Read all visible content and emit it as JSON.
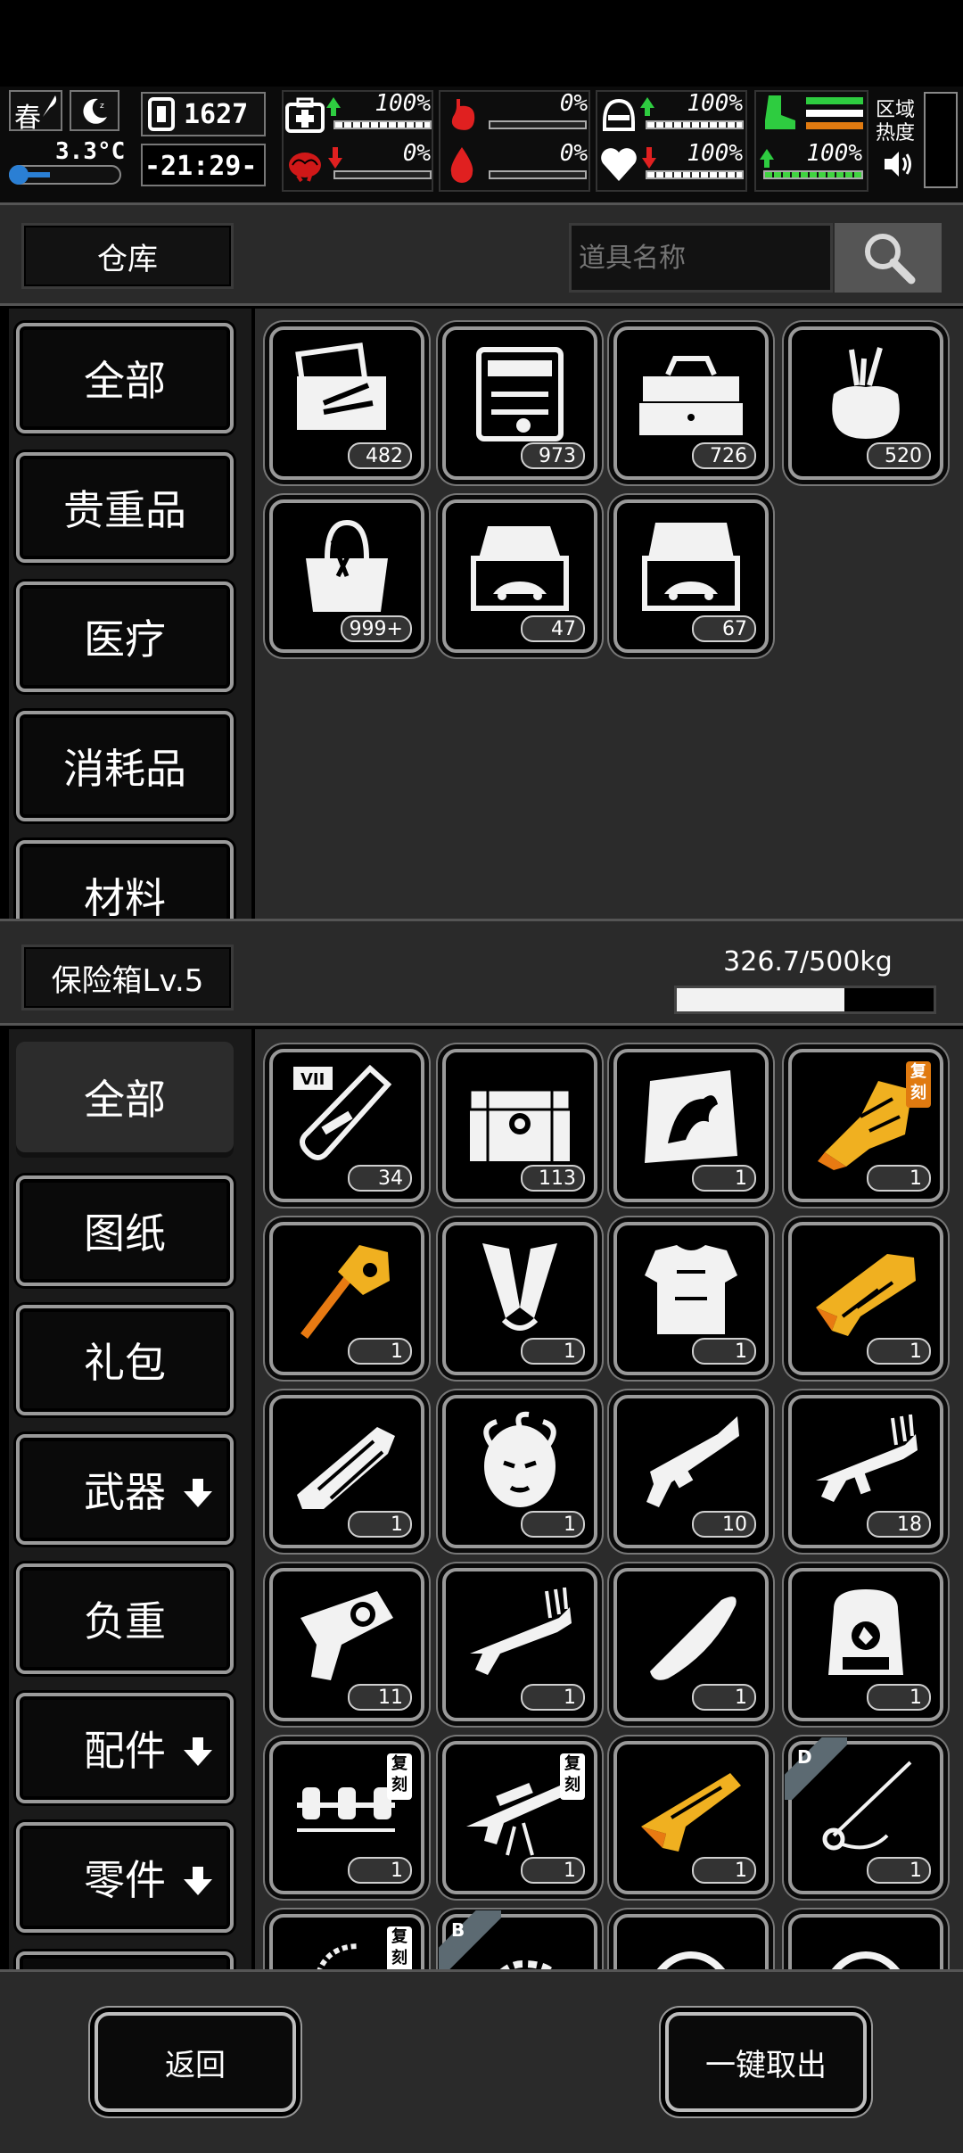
{
  "hud": {
    "season": "春",
    "temperature": "3.3°C",
    "day": "1627",
    "time": "-21:29-",
    "zone_heat_line1": "区域",
    "zone_heat_line2": "热度",
    "stats": [
      {
        "name": "health",
        "value": "100%",
        "trend": "up",
        "level": 1.0
      },
      {
        "name": "hunger",
        "value": "0%",
        "trend": "none",
        "level": 0.0
      },
      {
        "name": "armor",
        "value": "100%",
        "trend": "up",
        "level": 1.0
      },
      {
        "name": "brain",
        "value": "0%",
        "trend": "down",
        "level": 0.0
      },
      {
        "name": "blood",
        "value": "0%",
        "trend": "none",
        "level": 0.0
      },
      {
        "name": "heart",
        "value": "100%",
        "trend": "down",
        "level": 1.0
      },
      {
        "name": "stamina",
        "value": "100%",
        "trend": "up",
        "level": 1.0
      }
    ],
    "colors": {
      "green": "#2ecc40",
      "red": "#e02020",
      "orange": "#e07a10"
    }
  },
  "warehouse": {
    "title": "仓库",
    "search_placeholder": "道具名称",
    "categories": [
      "全部",
      "贵重品",
      "医疗",
      "消耗品",
      "材料"
    ],
    "items": [
      {
        "icon": "toolbox-pliers-icon",
        "count": "482"
      },
      {
        "icon": "toolkit-wrenches-icon",
        "count": "973"
      },
      {
        "icon": "tool-chest-icon",
        "count": "726"
      },
      {
        "icon": "tool-sack-icon",
        "count": "520"
      },
      {
        "icon": "tool-bag-icon",
        "count": "999+"
      },
      {
        "icon": "car-repair-kit-icon",
        "count": "47"
      },
      {
        "icon": "car-repair-kit-large-icon",
        "count": "67"
      }
    ]
  },
  "safebox": {
    "title": "保险箱Lv.5",
    "weight": "326.7/500kg",
    "weight_ratio": 0.6534,
    "categories": [
      {
        "label": "全部",
        "expandable": false
      },
      {
        "label": "图纸",
        "expandable": false
      },
      {
        "label": "礼包",
        "expandable": false
      },
      {
        "label": "武器",
        "expandable": true
      },
      {
        "label": "负重",
        "expandable": false
      },
      {
        "label": "配件",
        "expandable": true
      },
      {
        "label": "零件",
        "expandable": true
      }
    ],
    "items": [
      {
        "icon": "test-tube-vii-icon",
        "count": "34",
        "tag": "VII"
      },
      {
        "icon": "treasure-chest-icon",
        "count": "113"
      },
      {
        "icon": "blueprint-dragon-icon",
        "count": "1"
      },
      {
        "icon": "golden-gauntlet-icon",
        "count": "1",
        "copy": "复刻",
        "copy_style": "orange"
      },
      {
        "icon": "golden-mace-icon",
        "count": "1"
      },
      {
        "icon": "arm-guards-icon",
        "count": "1"
      },
      {
        "icon": "body-armor-icon",
        "count": "1"
      },
      {
        "icon": "golden-blaster-icon",
        "count": "1"
      },
      {
        "icon": "mech-cannon-icon",
        "count": "1"
      },
      {
        "icon": "medusa-mask-icon",
        "count": "1"
      },
      {
        "icon": "flamethrower-icon",
        "count": "10"
      },
      {
        "icon": "assault-rifle-icon",
        "count": "18"
      },
      {
        "icon": "scope-pistol-icon",
        "count": "11"
      },
      {
        "icon": "bayonet-rifle-icon",
        "count": "1"
      },
      {
        "icon": "curved-blade-icon",
        "count": "1"
      },
      {
        "icon": "backpack-icon",
        "count": "1"
      },
      {
        "icon": "ammo-belt-icon",
        "count": "1",
        "copy": "复刻",
        "copy_style": "white"
      },
      {
        "icon": "sniper-rifle-icon",
        "count": "1",
        "copy": "复刻",
        "copy_style": "white"
      },
      {
        "icon": "golden-shotgun-icon",
        "count": "1"
      },
      {
        "icon": "whip-sword-icon",
        "count": "1",
        "grade": "D"
      },
      {
        "icon": "headset-icon",
        "count": "",
        "copy": "复刻",
        "copy_style": "white"
      },
      {
        "icon": "coil-icon",
        "count": "",
        "grade": "B"
      },
      {
        "icon": "ornate-relic-icon",
        "count": ""
      },
      {
        "icon": "ornate-relic-icon",
        "count": ""
      }
    ]
  },
  "footer": {
    "back": "返回",
    "take_all": "一键取出"
  }
}
